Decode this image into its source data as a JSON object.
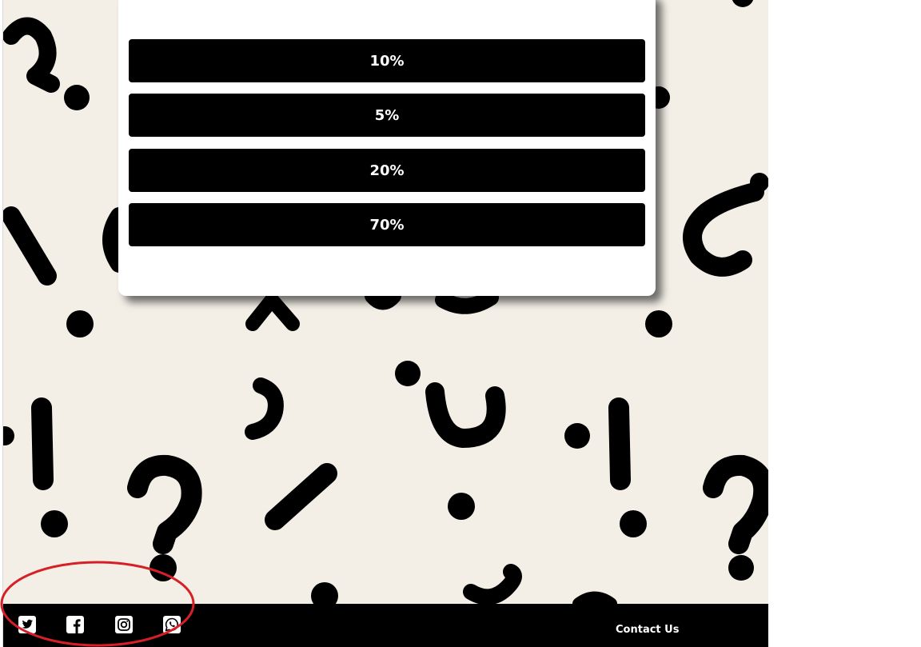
{
  "quiz": {
    "options": [
      {
        "label": "10%"
      },
      {
        "label": "5%"
      },
      {
        "label": "20%"
      },
      {
        "label": "70%"
      }
    ]
  },
  "footer": {
    "social": [
      "twitter-icon",
      "facebook-icon",
      "instagram-icon",
      "whatsapp-icon"
    ],
    "contact_label": "Contact Us"
  },
  "colors": {
    "background": "#f3efe7",
    "button": "#000000",
    "button_text": "#ffffff",
    "footer": "#000000",
    "annotation": "#d61f26"
  }
}
